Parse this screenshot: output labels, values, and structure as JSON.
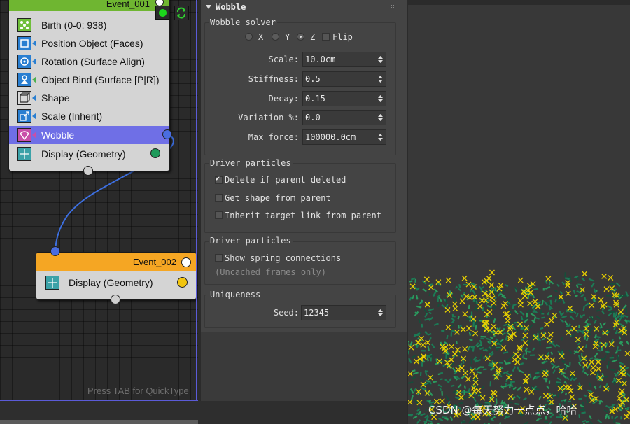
{
  "node_editor": {
    "event1": {
      "title": "Event_001",
      "operators": [
        {
          "label": "Birth (0-0: 938)",
          "icon": "birth-icon"
        },
        {
          "label": "Position Object (Faces)",
          "icon": "position-object-icon"
        },
        {
          "label": "Rotation (Surface Align)",
          "icon": "rotation-icon"
        },
        {
          "label": "Object Bind (Surface [P|R])",
          "icon": "object-bind-icon"
        },
        {
          "label": "Shape",
          "icon": "shape-icon"
        },
        {
          "label": "Scale (Inherit)",
          "icon": "scale-icon"
        },
        {
          "label": "Wobble",
          "icon": "wobble-icon",
          "selected": true
        },
        {
          "label": "Display (Geometry)",
          "icon": "display-icon"
        }
      ]
    },
    "event2": {
      "title": "Event_002",
      "operators": [
        {
          "label": "Display (Geometry)",
          "icon": "display-icon"
        }
      ]
    },
    "hint": "Press TAB for QuickType",
    "colors": {
      "event1_header": "#6fb631",
      "event2_header": "#f5a623",
      "selection": "#6f6fe6",
      "wire": "#3d6fe0"
    }
  },
  "panel": {
    "title": "Wobble",
    "solver": {
      "title": "Wobble solver",
      "axes": [
        {
          "label": "X",
          "checked": false
        },
        {
          "label": "Y",
          "checked": false
        },
        {
          "label": "Z",
          "checked": true
        }
      ],
      "flip_label": "Flip",
      "fields": [
        {
          "label": "Scale:",
          "value": "10.0cm"
        },
        {
          "label": "Stiffness:",
          "value": "0.5"
        },
        {
          "label": "Decay:",
          "value": "0.15"
        },
        {
          "label": "Variation %:",
          "value": "0.0"
        },
        {
          "label": "Max force:",
          "value": "100000.0cm"
        }
      ]
    },
    "driver1": {
      "title": "Driver particles",
      "options": [
        {
          "label": "Delete if parent deleted",
          "checked": true
        },
        {
          "label": "Get shape from parent",
          "checked": false
        },
        {
          "label": "Inherit target link from parent",
          "checked": false
        }
      ]
    },
    "driver2": {
      "title": "Driver particles",
      "option": {
        "label": "Show spring connections",
        "checked": false
      },
      "note": "(Uncached frames only)"
    },
    "uniqueness": {
      "title": "Uniqueness",
      "seed_label": "Seed:",
      "seed_value": "12345"
    }
  },
  "watermark": "CSDN @每天努力一点点，哈哈"
}
